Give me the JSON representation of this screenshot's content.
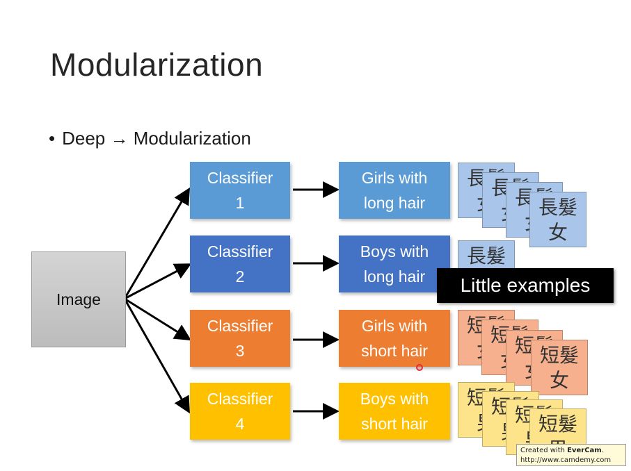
{
  "title": "Modularization",
  "bullet": {
    "marker": "•",
    "text": "Deep → Modularization"
  },
  "image_box": "Image",
  "classifiers": [
    {
      "label": "Classifier\n1",
      "color": "#5b9bd5"
    },
    {
      "label": "Classifier\n2",
      "color": "#4472c4"
    },
    {
      "label": "Classifier\n3",
      "color": "#ed7d31"
    },
    {
      "label": "Classifier\n4",
      "color": "#ffc000"
    }
  ],
  "outputs": [
    {
      "label": "Girls with\nlong hair"
    },
    {
      "label": "Boys with\nlong hair"
    },
    {
      "label": "Girls with\nshort hair"
    },
    {
      "label": "Boys with\nshort hair"
    }
  ],
  "cards": {
    "long_girls": "長髮\n女",
    "long_boys": "長髮\n男",
    "short_girls": "短髮\n女",
    "short_boys": "短髮\n男"
  },
  "callout": "Little examples",
  "watermark": {
    "line1_prefix": "Created with ",
    "brand": "EverCam",
    "line1_suffix": ".",
    "line2": "http://www.camdemy.com"
  }
}
